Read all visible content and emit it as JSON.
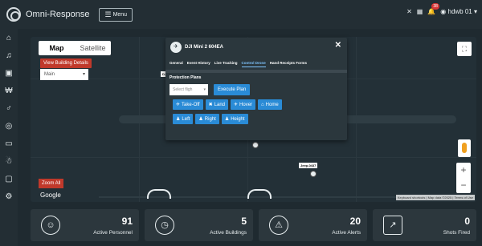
{
  "app": {
    "title": "Omni-Response",
    "menu_label": "Menu",
    "notification_count": "38",
    "user_label": "hdwb 01"
  },
  "sidebar": {
    "items": [
      "home-icon",
      "bell-icon",
      "report-icon",
      "receipt-icon",
      "tools-icon",
      "radar-icon",
      "truck-icon",
      "police-icon",
      "camera-icon",
      "settings-icon"
    ]
  },
  "map": {
    "tabs": [
      {
        "label": "Map",
        "active": true
      },
      {
        "label": "Satellite",
        "active": false
      }
    ],
    "view_building_label": "View Building Details",
    "building_select_value": "Main",
    "zoom_all_label": "Zoom All",
    "google_label": "Google",
    "attribution": "Keyboard shortcuts | Map data ©2025 | Terms of Use",
    "tags": {
      "jeep": "Jeep-0437",
      "dji_short": "DJ"
    },
    "markers": {
      "m1": "59",
      "m2": "63"
    }
  },
  "modal": {
    "title": "DJI Mini 2 604EA",
    "tabs": [
      {
        "label": "General",
        "active": false
      },
      {
        "label": "Event History",
        "active": false
      },
      {
        "label": "Live Tracking",
        "active": false
      },
      {
        "label": "Control Drone",
        "active": true
      },
      {
        "label": "Hand Receipts Forms",
        "active": false
      }
    ],
    "plans_label": "Protection Plans",
    "plan_select_placeholder": "Select fligh",
    "execute_label": "Execute Plan",
    "row1": [
      "Take-Off",
      "Land",
      "Hover",
      "Home"
    ],
    "row2": [
      "Left",
      "Right",
      "Height"
    ]
  },
  "stats": [
    {
      "value": "91",
      "label": "Active Personnel",
      "icon": "person-icon"
    },
    {
      "value": "5",
      "label": "Active Buildings",
      "icon": "clock-icon"
    },
    {
      "value": "20",
      "label": "Active Alerts",
      "icon": "alert-icon"
    },
    {
      "value": "0",
      "label": "Shots Fired",
      "icon": "chart-icon"
    }
  ],
  "colors": {
    "accent": "#2a8bd6",
    "danger": "#c0392b",
    "background": "#1f2a30"
  }
}
